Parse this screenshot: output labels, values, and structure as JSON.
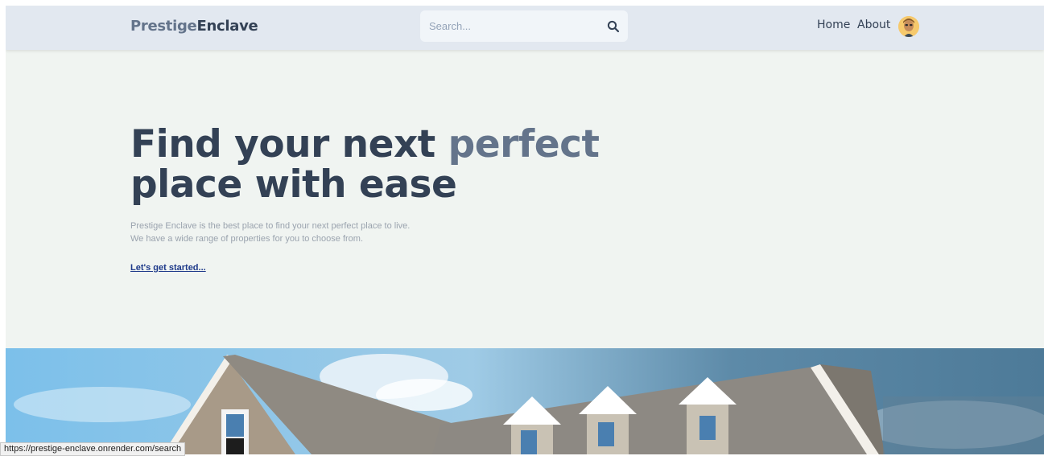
{
  "header": {
    "logo_part1": "Prestige",
    "logo_part2": "Enclave",
    "search_placeholder": "Search...",
    "search_icon": "search-icon",
    "nav": [
      "Home",
      "About"
    ],
    "avatar_icon": "user-avatar"
  },
  "hero": {
    "title_line1_a": "Find your next ",
    "title_line1_b": "perfect",
    "title_line2": "place with ease",
    "description_line1": "Prestige Enclave is the best place to find your next perfect place to live.",
    "description_line2": "We have a wide range of properties for you to choose from.",
    "cta": "Let's get started..."
  },
  "status_bar": {
    "url": "https://prestige-enclave.onrender.com/search"
  },
  "colors": {
    "header_bg": "#e2e8f0",
    "page_bg": "#f0f4f1",
    "title_dark": "#334155",
    "title_accent": "#64748b",
    "link": "#1e3a8a"
  }
}
